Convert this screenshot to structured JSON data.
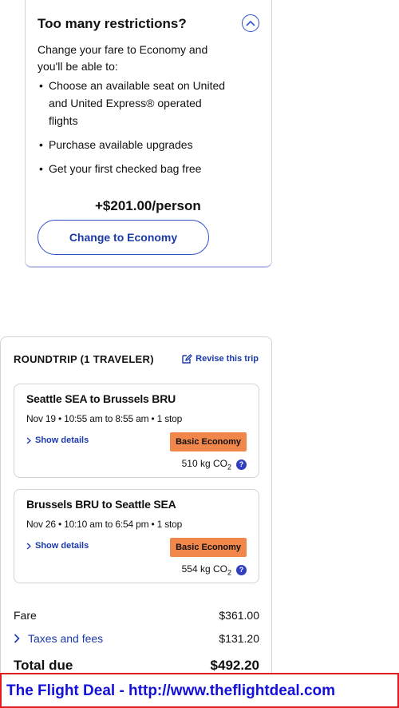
{
  "upsell": {
    "title": "Too many restrictions?",
    "intro": "Change your fare to Economy and you'll be able to:",
    "benefits": [
      "Choose an available seat on United and United Express® operated flights",
      "Purchase available upgrades",
      "Get your first checked bag free"
    ],
    "price": "+$201.00/person",
    "button_label": "Change to Economy",
    "collapse_icon": "chevron-up-icon"
  },
  "trip": {
    "header": "ROUNDTRIP (1 TRAVELER)",
    "revise_label": "Revise this trip",
    "segments": [
      {
        "route": "Seattle SEA to Brussels BRU",
        "time": "Nov 19 • 10:55 am to 8:55 am • 1 stop",
        "details_label": "Show details",
        "fare_class": "Basic Economy",
        "co2_value": "510 kg CO",
        "co2_sub": "2"
      },
      {
        "route": "Brussels BRU to Seattle SEA",
        "time": "Nov 26 • 10:10 am to 6:54 pm • 1 stop",
        "details_label": "Show details",
        "fare_class": "Basic Economy",
        "co2_value": "554 kg CO",
        "co2_sub": "2"
      }
    ],
    "fare_label": "Fare",
    "fare_value": "$361.00",
    "taxes_label": "Taxes and fees",
    "taxes_value": "$131.20",
    "total_label": "Total due",
    "total_value": "$492.20"
  },
  "banner": {
    "text": "The Flight Deal - http://www.theflightdeal.com"
  },
  "colors": {
    "link_blue": "#1b3aa8",
    "badge_orange": "#f2874b",
    "banner_red": "#e01c1c",
    "banner_text": "#1410d8"
  }
}
